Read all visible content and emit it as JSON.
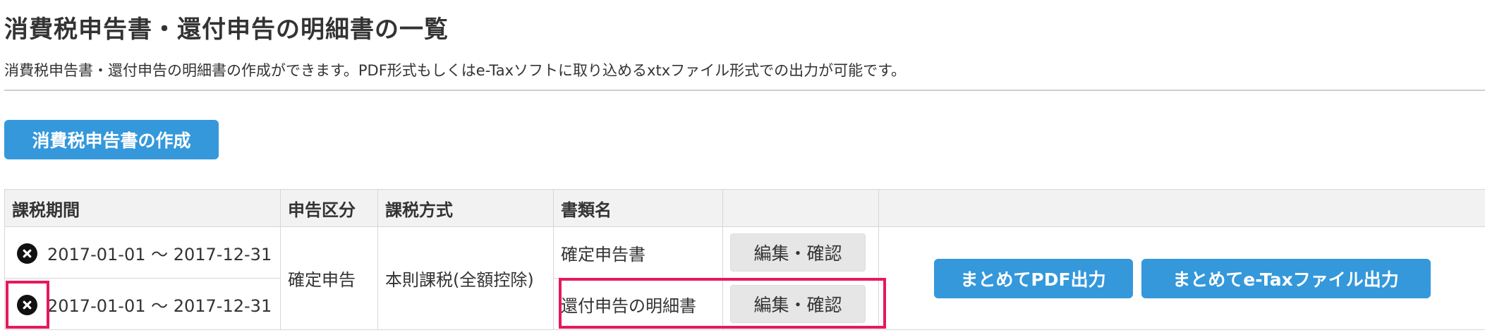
{
  "page": {
    "title": "消費税申告書・還付申告の明細書の一覧",
    "description": "消費税申告書・還付申告の明細書の作成ができます。PDF形式もしくはe-Taxソフトに取り込めるxtxファイル形式での出力が可能です。"
  },
  "actions": {
    "create_label": "消費税申告書の作成",
    "bulk_pdf_label": "まとめてPDF出力",
    "bulk_etax_label": "まとめてe-Taxファイル出力"
  },
  "table": {
    "headers": [
      "課税期間",
      "申告区分",
      "課税方式",
      "書類名",
      ""
    ],
    "filing_type": "確定申告",
    "tax_method": "本則課税(全額控除)",
    "rows": [
      {
        "period": "2017-01-01 〜 2017-12-31",
        "document": "確定申告書",
        "edit_label": "編集・確認"
      },
      {
        "period": "2017-01-01 〜 2017-12-31",
        "document": "還付申告の明細書",
        "edit_label": "編集・確認"
      }
    ]
  },
  "icons": {
    "remove": "close-circle-icon"
  },
  "colors": {
    "primary": "#3498db",
    "highlight": "#e6195c",
    "header_bg": "#f2f2f2"
  }
}
